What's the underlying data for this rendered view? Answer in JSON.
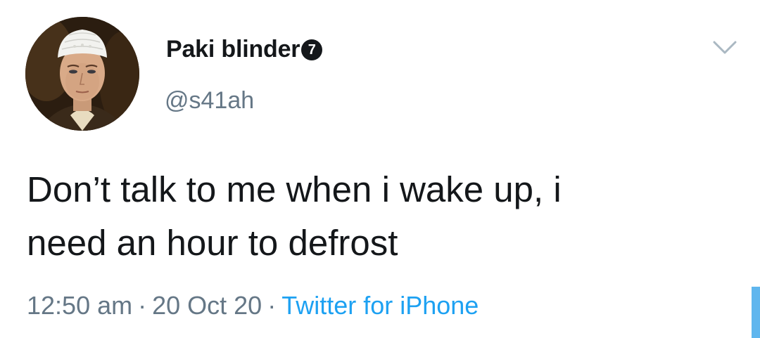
{
  "user": {
    "display_name": "Paki blinder",
    "badge": "7",
    "handle": "@s41ah"
  },
  "tweet": {
    "text_line1": "Don’t talk to me when i wake up, i",
    "text_line2": "need an hour to defrost",
    "time": "12:50 am",
    "date": "20 Oct 20",
    "separator": "·",
    "source": "Twitter for iPhone"
  },
  "icons": {
    "menu": "chevron-down-icon",
    "avatar": "profile-photo"
  },
  "colors": {
    "text": "#14171a",
    "secondary": "#657786",
    "link": "#1da1f2",
    "chevron": "#aab8c2"
  }
}
